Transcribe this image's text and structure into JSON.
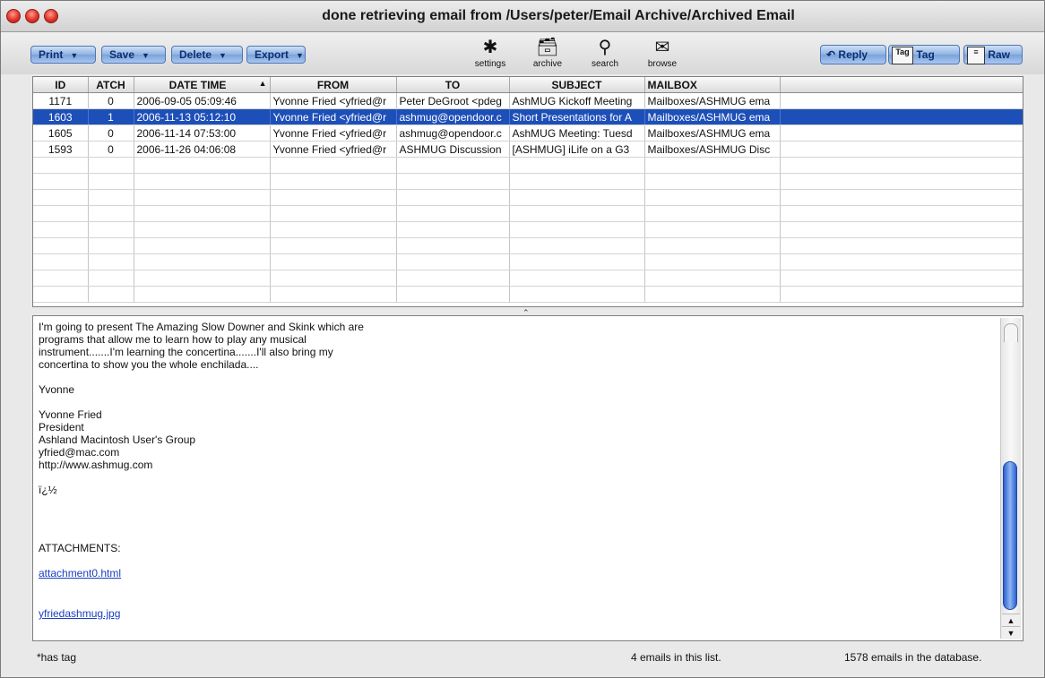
{
  "window": {
    "title": "done retrieving email from /Users/peter/Email Archive/Archived Email"
  },
  "toolbar": {
    "menus": [
      "Print",
      "Save",
      "Delete",
      "Export"
    ],
    "icons": [
      {
        "label": "settings",
        "icon": "gear-icon"
      },
      {
        "label": "archive",
        "icon": "archive-box-icon"
      },
      {
        "label": "search",
        "icon": "magnifier-icon"
      },
      {
        "label": "browse",
        "icon": "envelope-stack-icon"
      }
    ],
    "right": {
      "reply": "Reply",
      "tag_icon_label": "Tag",
      "tag": "Tag",
      "raw": "Raw"
    }
  },
  "table": {
    "columns": [
      "ID",
      "ATCH",
      "DATE TIME",
      "FROM",
      "TO",
      "SUBJECT",
      "MAILBOX"
    ],
    "sorted_column": "DATE TIME",
    "rows": [
      {
        "id": "1171",
        "atch": "0",
        "date": "2006-09-05 05:09:46",
        "from": "Yvonne Fried <yfried@r",
        "to": "Peter DeGroot <pdeg",
        "subject": "AshMUG Kickoff Meeting",
        "mailbox": "Mailboxes/ASHMUG ema",
        "selected": false
      },
      {
        "id": "1603",
        "atch": "1",
        "date": "2006-11-13 05:12:10",
        "from": "Yvonne Fried <yfried@r",
        "to": "ashmug@opendoor.c",
        "subject": "Short Presentations for A",
        "mailbox": "Mailboxes/ASHMUG ema",
        "selected": true
      },
      {
        "id": "1605",
        "atch": "0",
        "date": "2006-11-14 07:53:00",
        "from": "Yvonne Fried <yfried@r",
        "to": "ashmug@opendoor.c",
        "subject": "AshMUG Meeting:  Tuesd",
        "mailbox": "Mailboxes/ASHMUG ema",
        "selected": false
      },
      {
        "id": "1593",
        "atch": "0",
        "date": "2006-11-26 04:06:08",
        "from": "Yvonne Fried <yfried@r",
        "to": "ASHMUG Discussion",
        "subject": "[ASHMUG] iLife on a G3",
        "mailbox": "Mailboxes/ASHMUG Disc",
        "selected": false
      }
    ]
  },
  "message": {
    "body": "I'm going to present The Amazing Slow Downer and Skink which are\nprograms that allow me to learn how to play any musical\ninstrument.......I'm learning the concertina.......I'll also bring my\nconcertina to show you the whole enchilada....\n\nYvonne\n\nYvonne Fried\nPresident\nAshland Macintosh User's Group\nyfried@mac.com\nhttp://www.ashmug.com\n\nï¿½",
    "attachments_label": "ATTACHMENTS:",
    "attachments": [
      "attachment0.html",
      "yfriedashmug.jpg"
    ]
  },
  "status": {
    "left": "*has tag",
    "middle": "4 emails in this list.",
    "right": "1578 emails in the database."
  }
}
